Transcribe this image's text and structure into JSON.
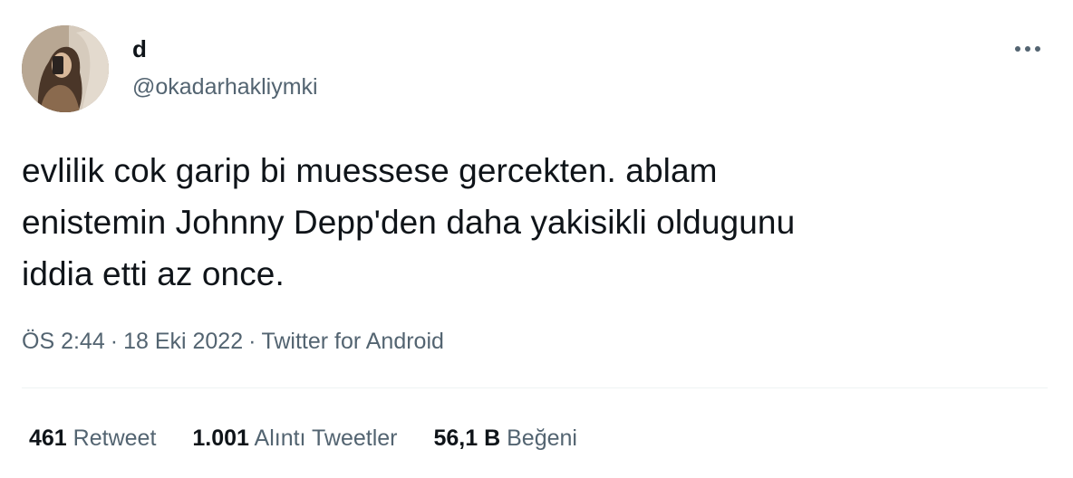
{
  "user": {
    "display_name": "d",
    "handle": "@okadarhakliymki"
  },
  "tweet": {
    "text": "evlilik cok garip bi muessese gercekten. ablam\nenistemin Johnny Depp'den daha yakisikli oldugunu\niddia etti az once."
  },
  "meta": {
    "time": "ÖS 2:44",
    "separator": "·",
    "date": "18 Eki 2022",
    "source": "Twitter for Android"
  },
  "stats": {
    "retweets": {
      "count": "461",
      "label": "Retweet"
    },
    "quotes": {
      "count": "1.001",
      "label": "Alıntı Tweetler"
    },
    "likes": {
      "count": "56,1 B",
      "label": "Beğeni"
    }
  },
  "icons": {
    "more": "more-horizontal-icon"
  },
  "colors": {
    "text_primary": "#0f1419",
    "text_secondary": "#536471",
    "divider": "#eff3f4"
  }
}
